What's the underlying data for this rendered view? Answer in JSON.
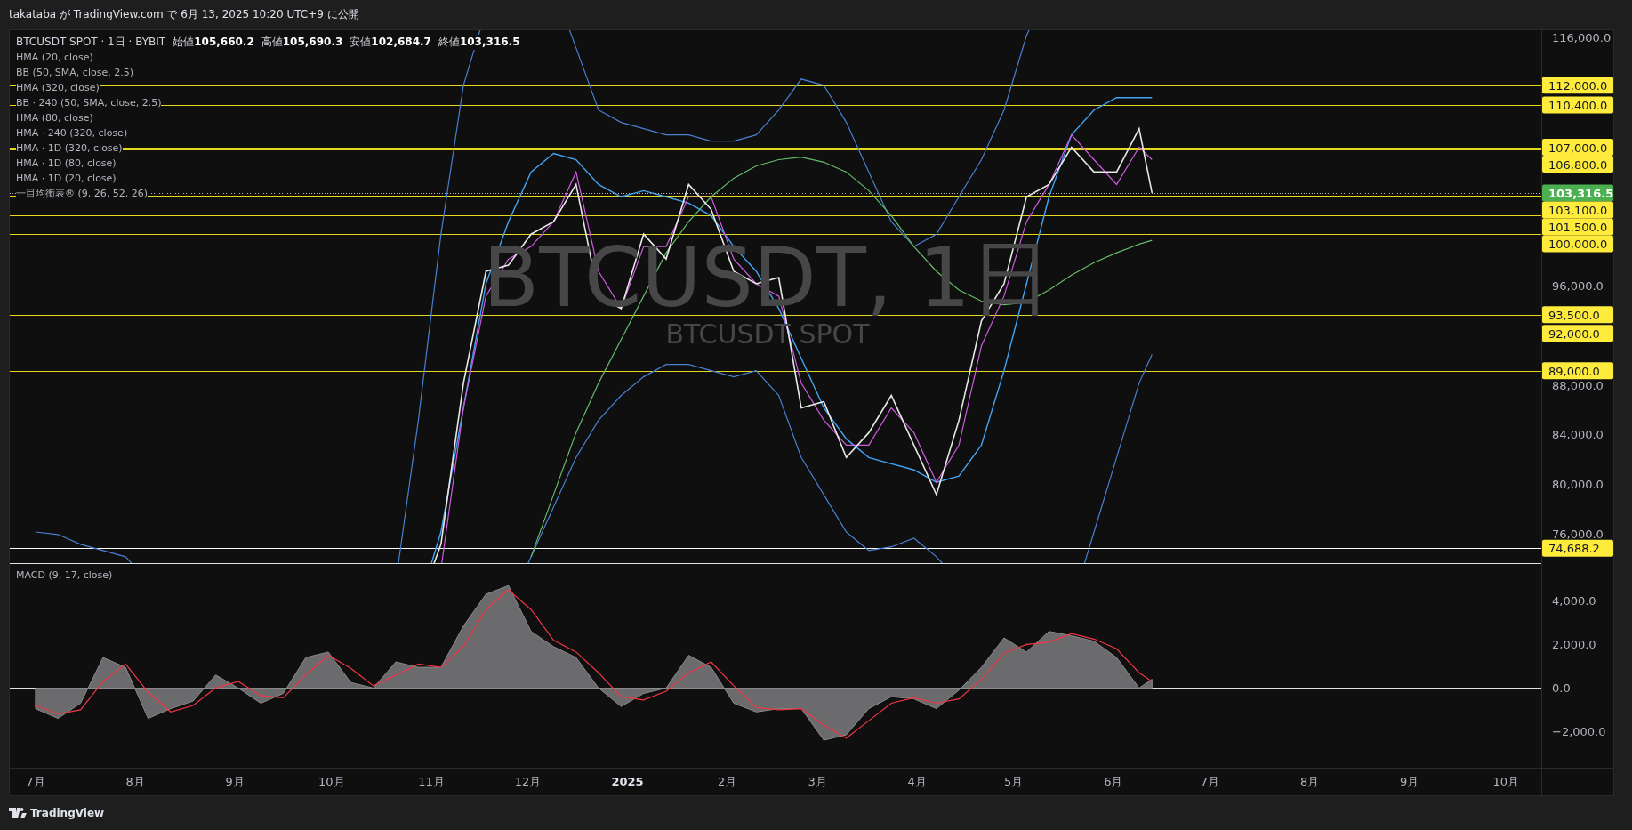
{
  "header": {
    "text": "takataba が TradingView.com で 6月 13, 2025 10:20 UTC+9 に公開"
  },
  "price_pane": {
    "symbol": "BTCUSDT SPOT · 1日 · BYBIT",
    "ohlc": [
      "始値**105,660.2**",
      "高値**105,690.3**",
      "安値**102,684.7**",
      "終値**103,316.5**"
    ],
    "indicators": [
      "HMA (20, close)",
      "BB (50, SMA, close, 2.5)",
      "HMA (320, close)",
      "BB · 240 (50, SMA, close, 2.5)",
      "HMA (80, close)",
      "HMA · 240 (320, close)",
      "HMA · 1D (320, close)",
      "HMA · 1D (80, close)",
      "HMA · 1D (20, close)",
      "一目均衡表® (9, 26, 52, 26)"
    ],
    "watermark": {
      "title": "BTCUSDT, 1日",
      "subtitle": "BTCUSDT SPOT"
    },
    "price_axis": [
      "116,000.0",
      "96,000.0",
      "88,000.0",
      "84,000.0",
      "80,000.0",
      "76,000.0"
    ],
    "levels": [
      {
        "label": "112,000.0",
        "kind": "level"
      },
      {
        "label": "110,400.0",
        "kind": "level"
      },
      {
        "label": "107,000.0",
        "kind": "level"
      },
      {
        "label": "106,800.0",
        "kind": "level"
      },
      {
        "label": "103,316.5",
        "kind": "last"
      },
      {
        "label": "103,100.0",
        "kind": "level"
      },
      {
        "label": "101,500.0",
        "kind": "level"
      },
      {
        "label": "100,000.0",
        "kind": "level"
      },
      {
        "label": "93,500.0",
        "kind": "level"
      },
      {
        "label": "92,000.0",
        "kind": "level"
      },
      {
        "label": "89,000.0",
        "kind": "level"
      },
      {
        "label": "74,688.2",
        "kind": "low"
      }
    ]
  },
  "macd_pane": {
    "legend": "MACD (9, 17, close)",
    "axis": [
      "4,000.0",
      "2,000.0",
      "0.0",
      "−2,000.0"
    ]
  },
  "time_axis": [
    {
      "label": "7月",
      "kind": "month"
    },
    {
      "label": "8月",
      "kind": "month"
    },
    {
      "label": "9月",
      "kind": "month"
    },
    {
      "label": "10月",
      "kind": "month"
    },
    {
      "label": "11月",
      "kind": "month"
    },
    {
      "label": "12月",
      "kind": "month"
    },
    {
      "label": "2025",
      "kind": "year"
    },
    {
      "label": "2月",
      "kind": "month"
    },
    {
      "label": "3月",
      "kind": "month"
    },
    {
      "label": "4月",
      "kind": "month"
    },
    {
      "label": "5月",
      "kind": "month"
    },
    {
      "label": "6月",
      "kind": "month"
    },
    {
      "label": "7月",
      "kind": "month"
    },
    {
      "label": "8月",
      "kind": "month"
    },
    {
      "label": "9月",
      "kind": "month"
    },
    {
      "label": "10月",
      "kind": "month"
    }
  ],
  "footer": {
    "brand": "TradingView"
  }
}
